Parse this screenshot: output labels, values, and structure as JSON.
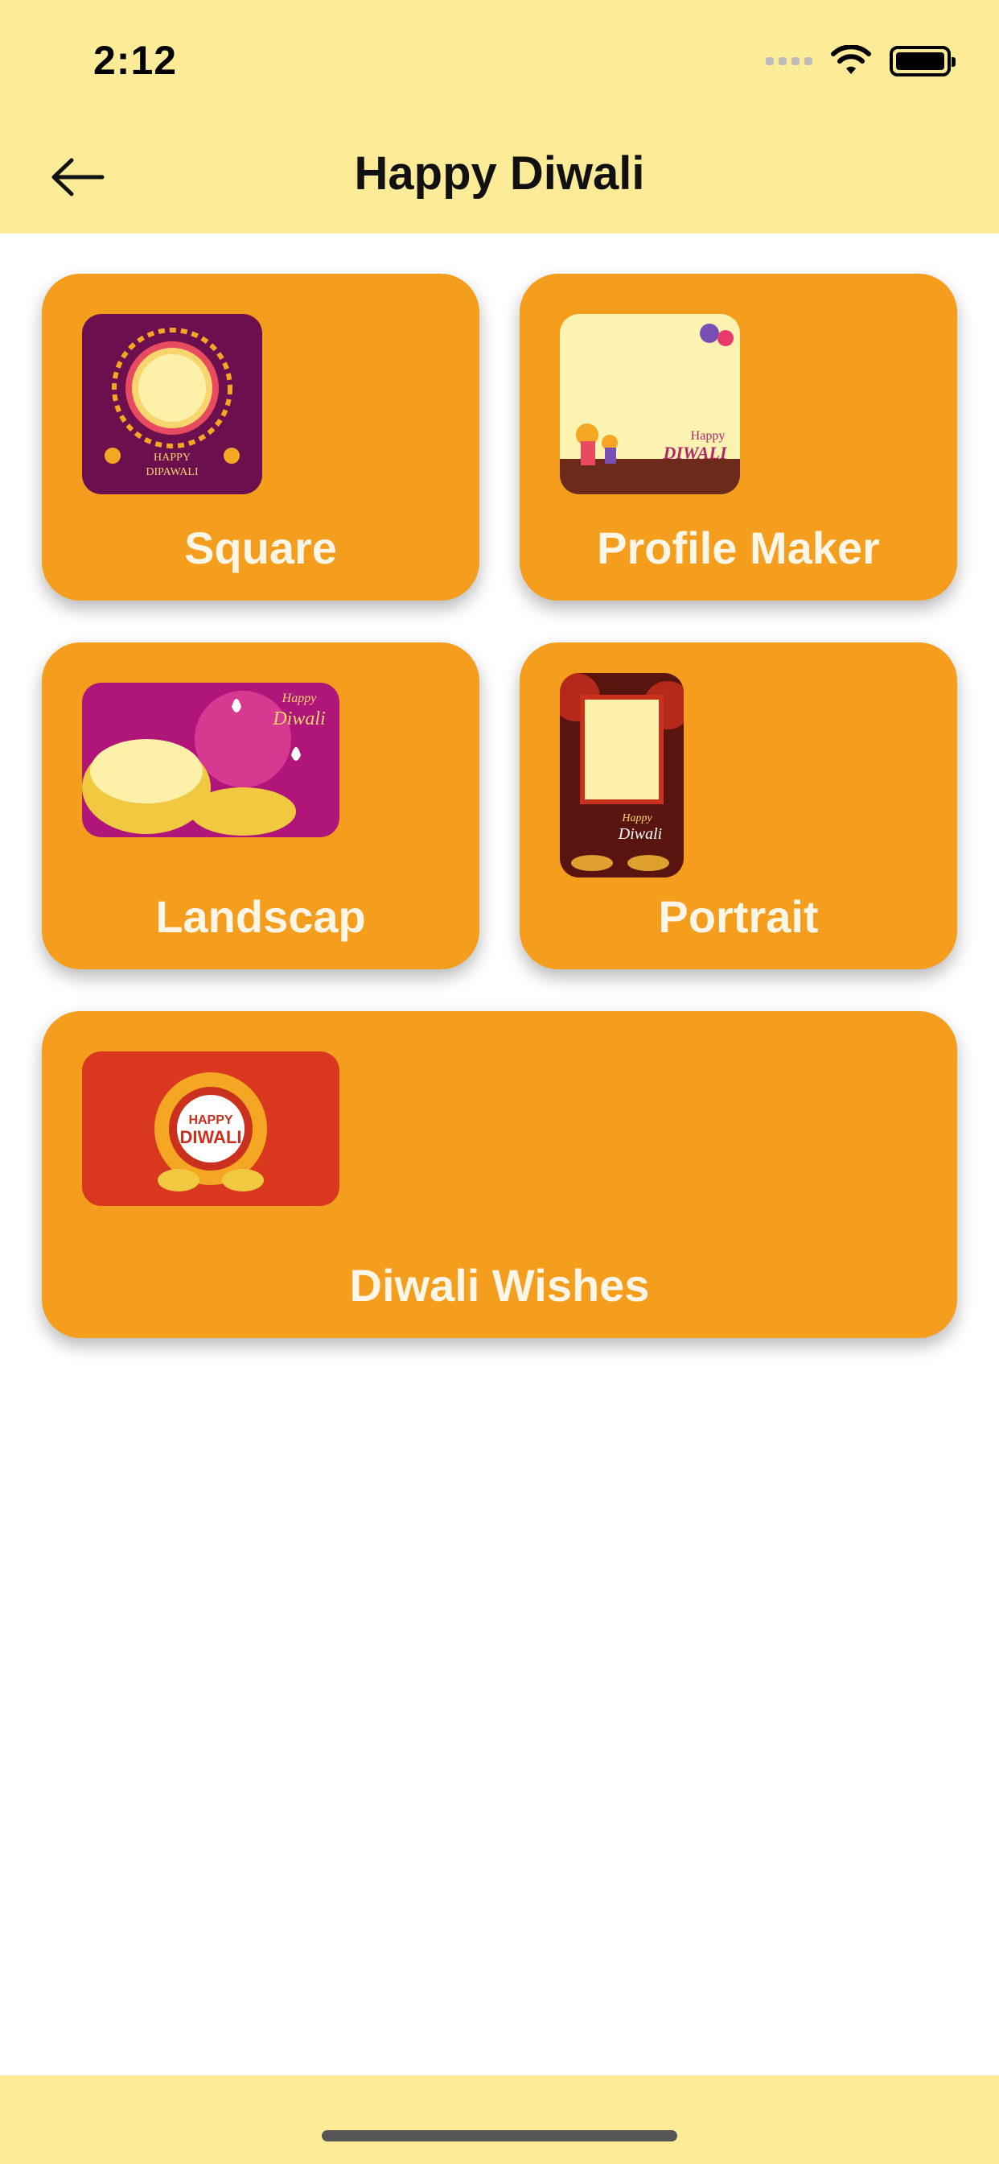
{
  "status": {
    "time": "2:12"
  },
  "header": {
    "title": "Happy Diwali",
    "back_icon": "arrow-left-icon"
  },
  "cards": [
    {
      "label": "Square",
      "thumb_text": [
        "HAPPY",
        "DIPAWALI"
      ]
    },
    {
      "label": "Profile Maker",
      "thumb_text": [
        "Happy",
        "DIWALI"
      ]
    },
    {
      "label": "Landscap",
      "thumb_text": [
        "Happy",
        "Diwali"
      ]
    },
    {
      "label": "Portrait",
      "thumb_text": [
        "Happy",
        "Diwali"
      ]
    },
    {
      "label": "Diwali Wishes",
      "thumb_text": [
        "HAPPY",
        "DIWALI"
      ]
    }
  ],
  "colors": {
    "header_bg": "#FDEB98",
    "card_bg": "#F59E1D",
    "card_text": "#FFF6E8"
  }
}
